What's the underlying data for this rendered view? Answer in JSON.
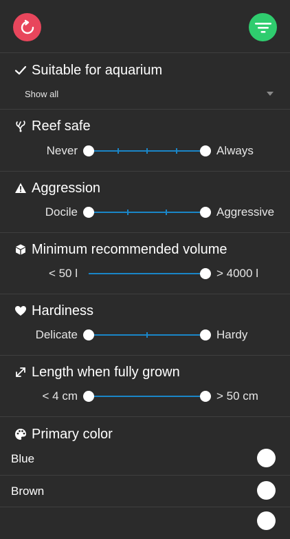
{
  "header": {
    "reset_icon": "refresh-icon",
    "filter_icon": "filter-icon",
    "colors": {
      "reset": "#e8465c",
      "filter": "#2fcc6e",
      "accent": "#1a86c8"
    }
  },
  "aquarium": {
    "title": "Suitable for aquarium",
    "icon": "checkmark-icon",
    "dropdown_value": "Show all"
  },
  "reef_safe": {
    "title": "Reef safe",
    "icon": "coral-icon",
    "min_label": "Never",
    "max_label": "Always",
    "range": [
      0,
      1
    ],
    "ticks": 3
  },
  "aggression": {
    "title": "Aggression",
    "icon": "warning-icon",
    "min_label": "Docile",
    "max_label": "Aggressive",
    "range": [
      0,
      1
    ],
    "ticks": 2
  },
  "volume": {
    "title": "Minimum recommended volume",
    "icon": "cube-icon",
    "min_label": "< 50 l",
    "max_label": "> 4000 l",
    "range": [
      0,
      1
    ],
    "ticks": 0
  },
  "hardiness": {
    "title": "Hardiness",
    "icon": "heart-icon",
    "min_label": "Delicate",
    "max_label": "Hardy",
    "range": [
      0,
      1
    ],
    "ticks": 1
  },
  "length": {
    "title": "Length when fully grown",
    "icon": "expand-arrows-icon",
    "min_label": "< 4 cm",
    "max_label": "> 50 cm",
    "range": [
      0,
      1
    ],
    "ticks": 0
  },
  "primary_color": {
    "title": "Primary color",
    "icon": "palette-icon",
    "options": [
      {
        "label": "Blue"
      },
      {
        "label": "Brown"
      }
    ]
  }
}
